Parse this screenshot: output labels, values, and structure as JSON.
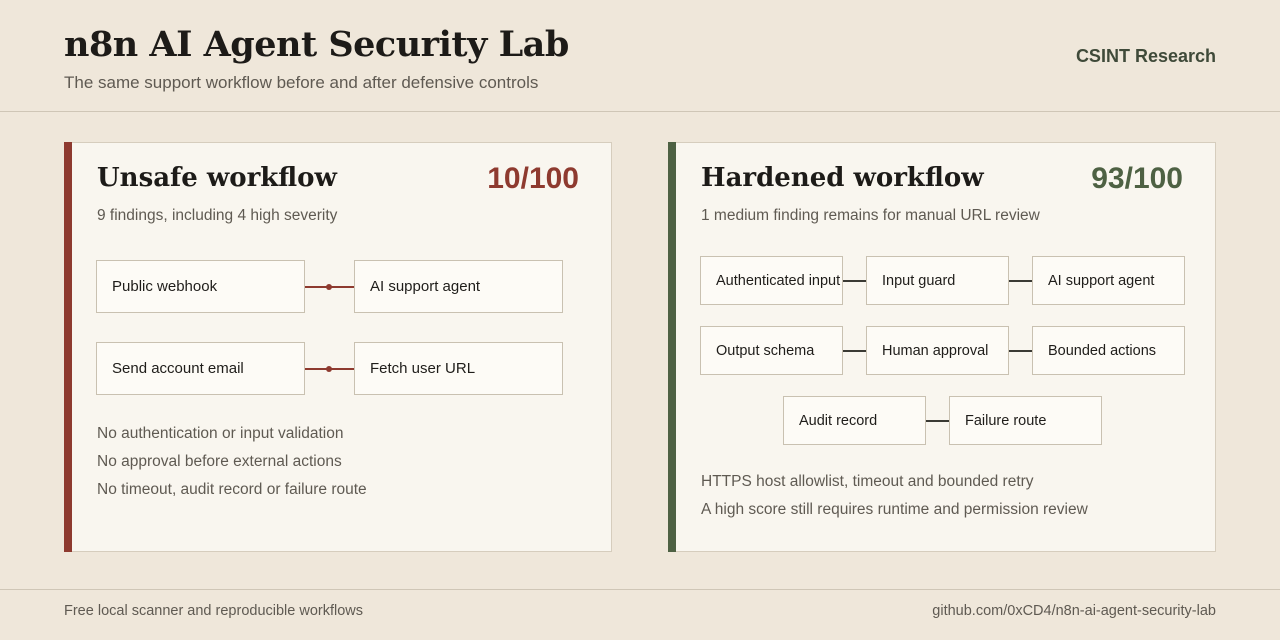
{
  "header": {
    "title": "n8n AI Agent Security Lab",
    "subtitle": "The same support workflow before and after defensive controls",
    "brand": "CSINT Research"
  },
  "unsafe": {
    "title": "Unsafe workflow",
    "score": "10/100",
    "summary": "9 findings, including 4 high severity",
    "accent": "#8e3a2f",
    "nodes": [
      "Public webhook",
      "AI support agent",
      "Send account email",
      "Fetch user URL"
    ],
    "notes": [
      "No authentication or input validation",
      "No approval before external actions",
      "No timeout, audit record or failure route"
    ]
  },
  "hardened": {
    "title": "Hardened workflow",
    "score": "93/100",
    "summary": "1 medium finding remains for manual URL review",
    "accent": "#4e6143",
    "nodes": [
      "Authenticated input",
      "Input guard",
      "AI support agent",
      "Output schema",
      "Human approval",
      "Bounded actions",
      "Audit record",
      "Failure route"
    ],
    "notes": [
      "HTTPS host allowlist, timeout and bounded retry",
      "A high score still requires runtime and permission review"
    ]
  },
  "footer": {
    "left": "Free local scanner and reproducible workflows",
    "right": "github.com/0xCD4/n8n-ai-agent-security-lab"
  }
}
